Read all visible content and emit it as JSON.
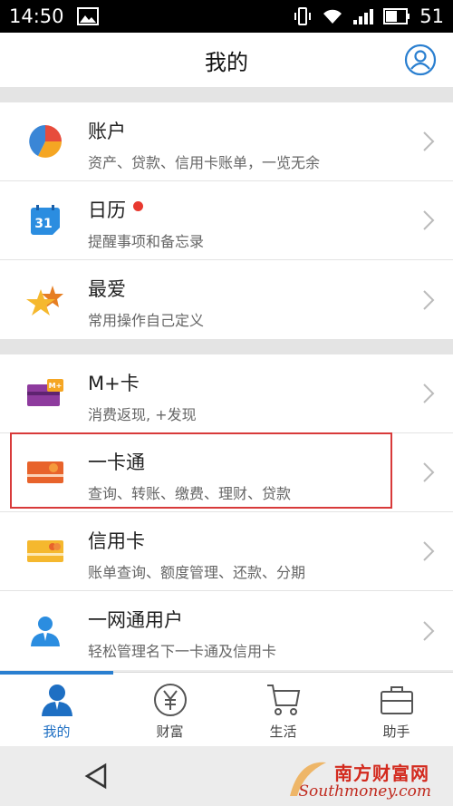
{
  "status_bar": {
    "time": "14:50",
    "battery": "51"
  },
  "header": {
    "title": "我的"
  },
  "groups": [
    {
      "items": [
        {
          "name": "账户",
          "desc": "资产、贷款、信用卡账单，一览无余",
          "icon": "pie-chart-icon"
        },
        {
          "name": "日历",
          "desc": "提醒事项和备忘录",
          "icon": "calendar-icon",
          "calendar_day": "31",
          "badge": true
        },
        {
          "name": "最爱",
          "desc": "常用操作自己定义",
          "icon": "star-icon"
        }
      ]
    },
    {
      "items": [
        {
          "name": "M+卡",
          "desc": "消费返现, +发现",
          "icon": "mplus-card-icon",
          "card_label": "M+"
        },
        {
          "name": "一卡通",
          "desc": "查询、转账、缴费、理财、贷款",
          "icon": "debit-card-icon",
          "highlighted": true
        },
        {
          "name": "信用卡",
          "desc": "账单查询、额度管理、还款、分期",
          "icon": "credit-card-icon"
        },
        {
          "name": "一网通用户",
          "desc": "轻松管理名下一卡通及信用卡",
          "icon": "user-icon"
        }
      ]
    }
  ],
  "tabs": [
    {
      "label": "我的",
      "icon": "person-icon",
      "active": true
    },
    {
      "label": "财富",
      "icon": "yuan-icon",
      "active": false
    },
    {
      "label": "生活",
      "icon": "cart-icon",
      "active": false
    },
    {
      "label": "助手",
      "icon": "briefcase-icon",
      "active": false
    }
  ],
  "watermark": {
    "cn": "南方财富网",
    "en": "Southmoney.com"
  },
  "colors": {
    "accent": "#1e6fc3",
    "highlight": "#d83a3a",
    "badge": "#e8392f"
  }
}
